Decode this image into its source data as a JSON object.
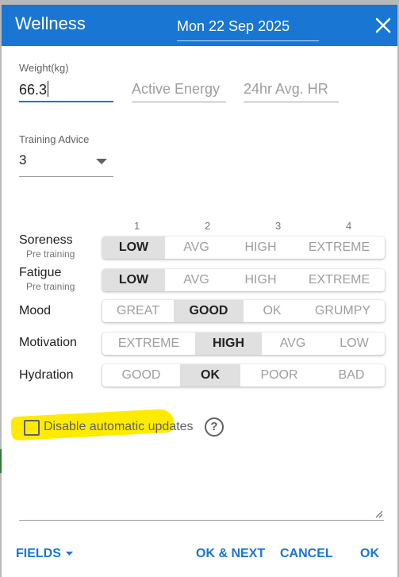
{
  "header": {
    "title": "Wellness",
    "date": "Mon 22 Sep 2025",
    "close_icon": "close-icon"
  },
  "fields": {
    "weight": {
      "label": "Weight(kg)",
      "value": "66.3"
    },
    "active_energy": {
      "placeholder": "Active Energy"
    },
    "avg_hr": {
      "placeholder": "24hr Avg. HR"
    },
    "training_advice": {
      "label": "Training Advice",
      "value": "3"
    }
  },
  "scale_numbers": [
    "1",
    "2",
    "3",
    "4"
  ],
  "rows": {
    "soreness": {
      "label": "Soreness",
      "sub": "Pre training",
      "options": [
        "LOW",
        "AVG",
        "HIGH",
        "EXTREME"
      ],
      "selected": "LOW"
    },
    "fatigue": {
      "label": "Fatigue",
      "sub": "Pre training",
      "options": [
        "LOW",
        "AVG",
        "HIGH",
        "EXTREME"
      ],
      "selected": "LOW"
    },
    "mood": {
      "label": "Mood",
      "options": [
        "GREAT",
        "GOOD",
        "OK",
        "GRUMPY"
      ],
      "selected": "GOOD"
    },
    "motivation": {
      "label": "Motivation",
      "options": [
        "EXTREME",
        "HIGH",
        "AVG",
        "LOW"
      ],
      "selected": "HIGH"
    },
    "hydration": {
      "label": "Hydration",
      "options": [
        "GOOD",
        "OK",
        "POOR",
        "BAD"
      ],
      "selected": "OK"
    }
  },
  "disable_updates": {
    "label": "Disable automatic updates",
    "checked": false
  },
  "help_icon": "question-mark-circle-icon",
  "footer": {
    "fields": "FIELDS",
    "ok_next": "OK & NEXT",
    "cancel": "CANCEL",
    "ok": "OK"
  },
  "colors": {
    "primary": "#1976d2",
    "highlight": "#ffeb00",
    "selected_segment": "#e0e0e0"
  }
}
